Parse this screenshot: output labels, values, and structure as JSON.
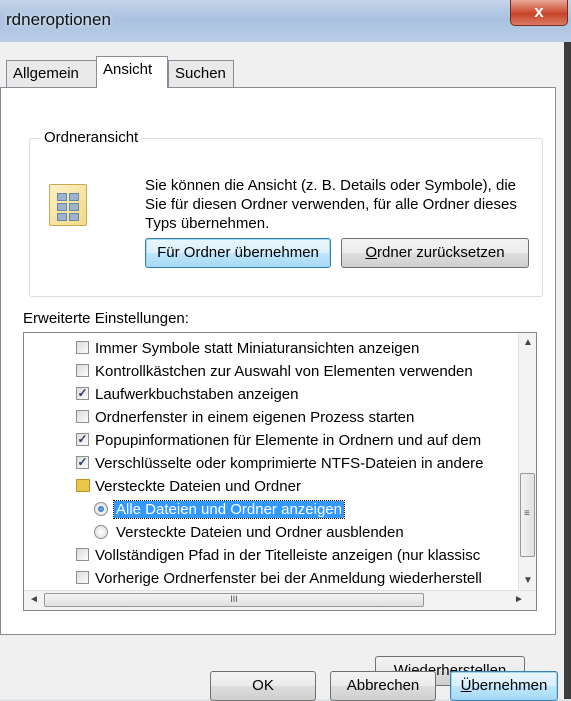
{
  "window": {
    "title": "rdneroptionen",
    "close_label": "x"
  },
  "tabs": [
    {
      "label": "Allgemein"
    },
    {
      "label": "Ansicht"
    },
    {
      "label": "Suchen"
    }
  ],
  "folder_view": {
    "group_label": "Ordneransicht",
    "description": "Sie können die Ansicht (z. B. Details oder Symbole), die Sie für diesen Ordner verwenden, für alle Ordner dieses Typs übernehmen.",
    "apply_button": "Für Ordner übernehmen",
    "reset_button_accel": "O",
    "reset_button_rest": "rdner zurücksetzen"
  },
  "advanced": {
    "label": "Erweiterte Einstellungen:",
    "items": [
      {
        "label": "Immer Symbole statt Miniaturansichten anzeigen",
        "type": "checkbox",
        "checked": false
      },
      {
        "label": "Kontrollkästchen zur Auswahl von Elementen verwenden",
        "type": "checkbox",
        "checked": false
      },
      {
        "label": "Laufwerkbuchstaben anzeigen",
        "type": "checkbox",
        "checked": true
      },
      {
        "label": "Ordnerfenster in einem eigenen Prozess starten",
        "type": "checkbox",
        "checked": false
      },
      {
        "label": "Popupinformationen für Elemente in Ordnern und auf dem",
        "type": "checkbox",
        "checked": true
      },
      {
        "label": "Verschlüsselte oder komprimierte NTFS-Dateien in andere",
        "type": "checkbox",
        "checked": true
      },
      {
        "label": "Versteckte Dateien und Ordner",
        "type": "folder"
      },
      {
        "label": "Alle Dateien und Ordner anzeigen",
        "type": "radio",
        "checked": true
      },
      {
        "label": "Versteckte Dateien und Ordner ausblenden",
        "type": "radio",
        "checked": false
      },
      {
        "label": "Vollständigen Pfad in der Titelleiste anzeigen (nur klassisc",
        "type": "checkbox",
        "checked": false
      },
      {
        "label": "Vorherige Ordnerfenster bei der Anmeldung wiederherstell",
        "type": "checkbox",
        "checked": false
      }
    ],
    "check_mark": "✓",
    "scroll_grip": "III",
    "grip_v": "≡",
    "arrow_up": "▲",
    "arrow_down": "▼",
    "arrow_left": "◄",
    "arrow_right": "►"
  },
  "restore_button_accel": "W",
  "restore_button_rest": "iederherstellen",
  "footer": {
    "ok": "OK",
    "cancel": "Abbrechen",
    "apply_accel": "Ü",
    "apply_rest": "bernehmen"
  },
  "colors": {
    "selection": "#3399ff",
    "close_button": "#c7432a"
  }
}
